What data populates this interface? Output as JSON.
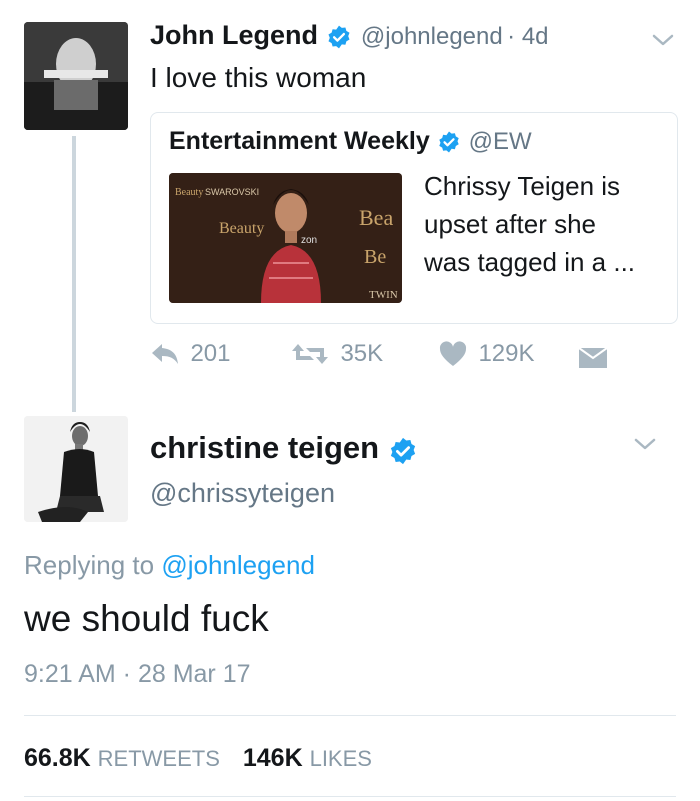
{
  "tweet1": {
    "name": "John Legend",
    "handle": "@johnlegend",
    "time": "· 4d",
    "text": "I love this woman",
    "quote": {
      "name": "Entertainment Weekly",
      "handle": "@EW",
      "text_lines": [
        "Chrissy Teigen is",
        "upset after she",
        "was tagged in a ..."
      ]
    },
    "actions": {
      "reply_count": "201",
      "retweet_count": "35K",
      "like_count": "129K"
    }
  },
  "tweet2": {
    "name": "christine teigen",
    "handle": "@chrissyteigen",
    "replying_prefix": "Replying to",
    "replying_handle": "@johnlegend",
    "text": "we should fuck",
    "timestamp": "9:21 AM · 28 Mar 17",
    "retweets_count": "66.8K",
    "retweets_label": "RETWEETS",
    "likes_count": "146K",
    "likes_label": "LIKES"
  },
  "colors": {
    "verified_blue": "#1da1f2",
    "link_blue": "#1da1f2",
    "muted_gray": "#8899a6",
    "text_dark": "#14171a"
  },
  "icons": [
    "verified-badge-icon",
    "chevron-down-icon",
    "reply-icon",
    "retweet-icon",
    "heart-icon",
    "message-icon"
  ]
}
